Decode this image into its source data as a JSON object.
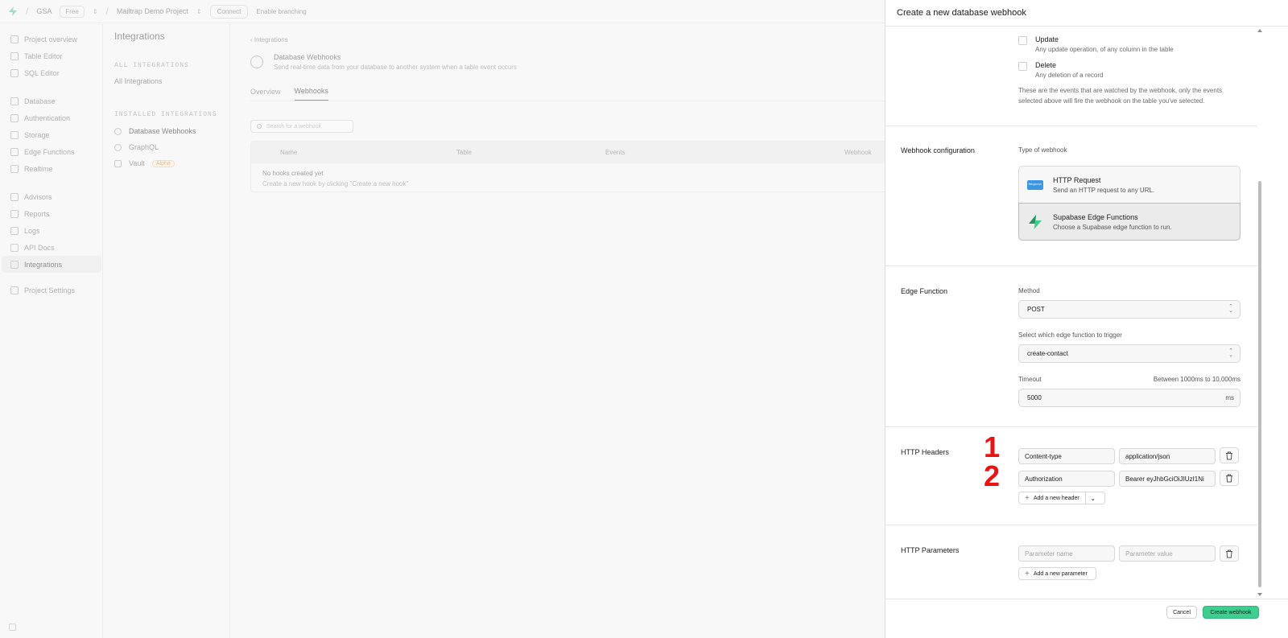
{
  "topbar": {
    "org": "GSA",
    "plan": "Free",
    "project": "Mailtrap Demo Project",
    "connect": "Connect",
    "branching": "Enable branching"
  },
  "leftnav": {
    "items": [
      {
        "label": "Project overview",
        "icon": "home-icon"
      },
      {
        "label": "Table Editor",
        "icon": "table-icon"
      },
      {
        "label": "SQL Editor",
        "icon": "terminal-icon"
      },
      {
        "label": "Database",
        "icon": "database-icon"
      },
      {
        "label": "Authentication",
        "icon": "users-icon"
      },
      {
        "label": "Storage",
        "icon": "archive-icon"
      },
      {
        "label": "Edge Functions",
        "icon": "code-icon"
      },
      {
        "label": "Realtime",
        "icon": "realtime-icon"
      },
      {
        "label": "Advisors",
        "icon": "lightbulb-icon"
      },
      {
        "label": "Reports",
        "icon": "chart-icon"
      },
      {
        "label": "Logs",
        "icon": "list-icon"
      },
      {
        "label": "API Docs",
        "icon": "file-icon"
      },
      {
        "label": "Integrations",
        "icon": "blocks-icon"
      },
      {
        "label": "Project Settings",
        "icon": "gear-icon"
      }
    ]
  },
  "subnav": {
    "title": "Integrations",
    "all_section": "ALL INTEGRATIONS",
    "all_link": "All Integrations",
    "installed_section": "INSTALLED INTEGRATIONS",
    "installed": [
      {
        "label": "Database Webhooks"
      },
      {
        "label": "GraphQL"
      },
      {
        "label": "Vault",
        "badge": "Alpha"
      }
    ]
  },
  "main": {
    "breadcrumb": "Integrations",
    "title": "Database Webhooks",
    "subtitle": "Send real-time data from your database to another system when a table event occurs",
    "tabs": [
      "Overview",
      "Webhooks"
    ],
    "search_placeholder": "Search for a webhook",
    "columns": [
      "Name",
      "Table",
      "Events",
      "Webhook"
    ],
    "empty_title": "No hooks created yet",
    "empty_desc": "Create a new hook by clicking \"Create a new hook\""
  },
  "panel": {
    "title": "Create a new database webhook",
    "events": {
      "update_title": "Update",
      "update_desc": "Any update operation, of any column in the table",
      "delete_title": "Delete",
      "delete_desc": "Any deletion of a record",
      "help": "These are the events that are watched by the webhook, only the events selected above will fire the webhook on the table you've selected."
    },
    "config": {
      "label": "Webhook configuration",
      "type_label": "Type of webhook",
      "http_title": "HTTP Request",
      "http_desc": "Send an HTTP request to any URL.",
      "http_icon_text": "Request",
      "edge_title": "Supabase Edge Functions",
      "edge_desc": "Choose a Supabase edge function to run."
    },
    "edge": {
      "label": "Edge Function",
      "method_label": "Method",
      "method_value": "POST",
      "function_label": "Select which edge function to trigger",
      "function_value": "create-contact",
      "timeout_label": "Timeout",
      "timeout_hint": "Between 1000ms to 10,000ms",
      "timeout_value": "5000",
      "timeout_unit": "ms"
    },
    "headers": {
      "label": "HTTP Headers",
      "rows": [
        {
          "name": "Content-type",
          "value": "application/json"
        },
        {
          "name": "Authorization",
          "value": "Bearer eyJhbGciOiJIUzI1Ni"
        }
      ],
      "add_label": "Add a new header"
    },
    "params": {
      "label": "HTTP Parameters",
      "name_placeholder": "Parameter name",
      "value_placeholder": "Parameter value",
      "add_label": "Add a new parameter"
    },
    "annotations": [
      "1",
      "2"
    ],
    "footer": {
      "cancel": "Cancel",
      "create": "Create webhook"
    }
  },
  "colors": {
    "brand_green": "#3ecf8e",
    "annotation_red": "#ee1111",
    "http_blue": "#3b97e3"
  }
}
